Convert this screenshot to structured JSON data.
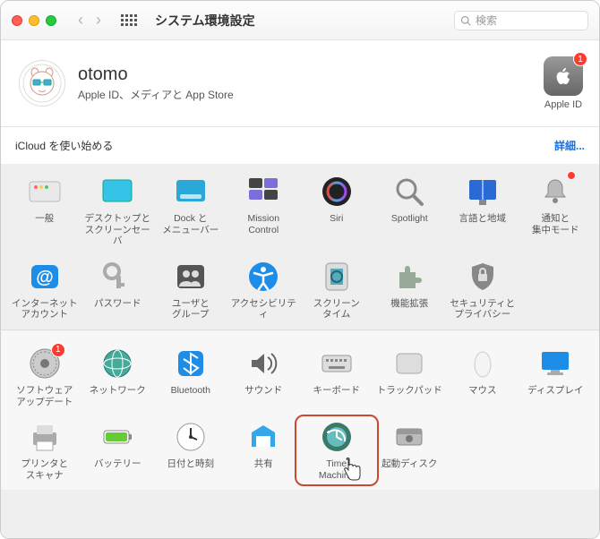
{
  "window": {
    "title": "システム環境設定"
  },
  "search": {
    "placeholder": "検索"
  },
  "account": {
    "name": "otomo",
    "subtitle": "Apple ID、メディアと App Store",
    "apple_id_label": "Apple ID",
    "apple_id_badge": "1"
  },
  "icloud": {
    "label": "iCloud を使い始める",
    "details": "詳細..."
  },
  "panel1": [
    {
      "id": "general",
      "label": "一般"
    },
    {
      "id": "desktop",
      "label": "デスクトップと\nスクリーンセーバ"
    },
    {
      "id": "dock",
      "label": "Dock と\nメニューバー"
    },
    {
      "id": "mission",
      "label": "Mission\nControl"
    },
    {
      "id": "siri",
      "label": "Siri"
    },
    {
      "id": "spotlight",
      "label": "Spotlight"
    },
    {
      "id": "language",
      "label": "言語と地域"
    },
    {
      "id": "notifications",
      "label": "通知と\n集中モード",
      "badge": true
    },
    {
      "id": "internet",
      "label": "インターネット\nアカウント"
    },
    {
      "id": "passwords",
      "label": "パスワード"
    },
    {
      "id": "users",
      "label": "ユーザと\nグループ"
    },
    {
      "id": "accessibility",
      "label": "アクセシビリティ"
    },
    {
      "id": "screentime",
      "label": "スクリーン\nタイム"
    },
    {
      "id": "extensions",
      "label": "機能拡張"
    },
    {
      "id": "security",
      "label": "セキュリティと\nプライバシー"
    }
  ],
  "panel2": [
    {
      "id": "software",
      "label": "ソフトウェア\nアップデート",
      "badge": "1"
    },
    {
      "id": "network",
      "label": "ネットワーク"
    },
    {
      "id": "bluetooth",
      "label": "Bluetooth"
    },
    {
      "id": "sound",
      "label": "サウンド"
    },
    {
      "id": "keyboard",
      "label": "キーボード"
    },
    {
      "id": "trackpad",
      "label": "トラックパッド"
    },
    {
      "id": "mouse",
      "label": "マウス"
    },
    {
      "id": "displays",
      "label": "ディスプレイ"
    },
    {
      "id": "printers",
      "label": "プリンタと\nスキャナ"
    },
    {
      "id": "battery",
      "label": "バッテリー"
    },
    {
      "id": "datetime",
      "label": "日付と時刻"
    },
    {
      "id": "sharing",
      "label": "共有"
    },
    {
      "id": "timemachine",
      "label": "Time\nMachine",
      "highlight": true
    },
    {
      "id": "startup",
      "label": "起動ディスク"
    }
  ]
}
